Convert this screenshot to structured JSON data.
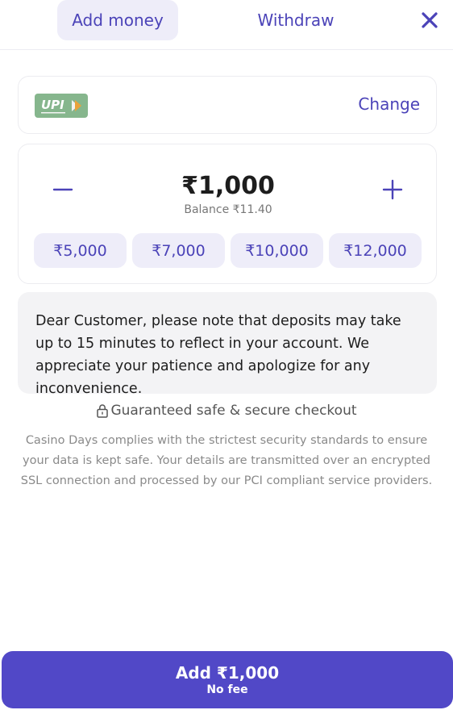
{
  "tabs": {
    "add_money": "Add money",
    "withdraw": "Withdraw"
  },
  "payment_method": {
    "logo_icon": "upi-logo",
    "change_label": "Change"
  },
  "amount": {
    "value": "₹1,000",
    "balance": "Balance ₹11.40",
    "quick_amounts": [
      "₹5,000",
      "₹7,000",
      "₹10,000",
      "₹12,000"
    ]
  },
  "notice": "Dear Customer, please note that deposits may take up to 15 minutes to reflect in your account. We appreciate your patience and apologize for any inconvenience.",
  "secure": {
    "icon": "lock-icon",
    "title": "Guaranteed safe & secure checkout",
    "description": "Casino Days complies with the strictest security standards to ensure your data is kept safe. Your details are transmitted over an encrypted SSL connection and processed by our PCI compliant service providers."
  },
  "cta": {
    "label": "Add ₹1,000",
    "sublabel": "No fee"
  },
  "colors": {
    "accent": "#4b43b8",
    "accent_light": "#eeedf9",
    "cta_bg": "#5148c7",
    "upi_green": "#86b68d"
  }
}
